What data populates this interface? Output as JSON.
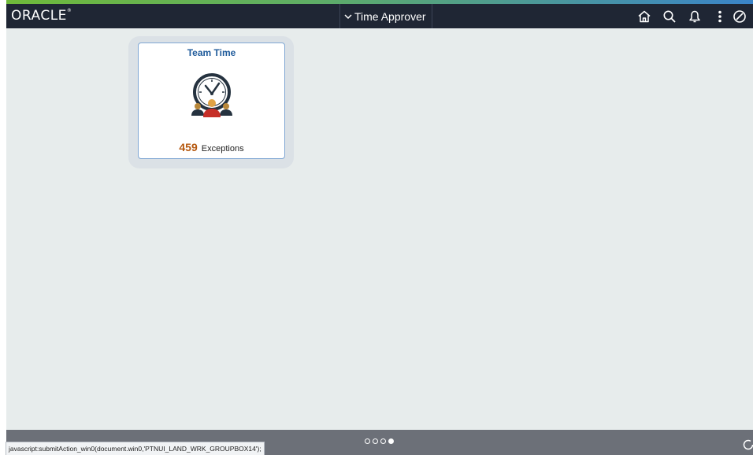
{
  "header": {
    "logo": "ORACLE",
    "logo_mark": "®",
    "role_selector": {
      "label": "Time Approver",
      "icon": "chevron-down-icon"
    },
    "icons": [
      "home-icon",
      "search-icon",
      "notifications-bell-icon",
      "actions-menu-icon",
      "navbar-compass-icon"
    ]
  },
  "tiles": [
    {
      "title": "Team Time",
      "icon": "team-clock-icon",
      "metric_value": "459",
      "metric_label": "Exceptions"
    }
  ],
  "footer": {
    "status_text": "javascript:submitAction_win0(document.win0,'PTNUI_LAND_WRK_GROUPBOX14');",
    "page_dots": {
      "count": 4,
      "active_index": 3
    },
    "refresh_icon": "refresh-icon"
  },
  "colors": {
    "header_bg": "#1f2634",
    "content_bg": "#e7ecec",
    "tile_title": "#1e5a9a",
    "metric_number": "#b5580f",
    "footer_bg": "#6c7078",
    "accent_green": "#6fb93a",
    "accent_blue": "#3a84c9"
  }
}
